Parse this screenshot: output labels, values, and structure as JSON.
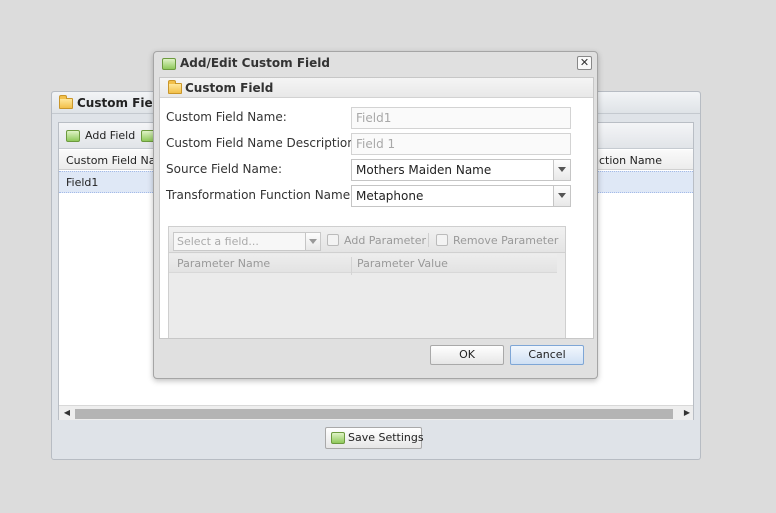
{
  "background_panel": {
    "title": "Custom Field C",
    "toolbar": {
      "add_field_label": "Add Field"
    },
    "columns": [
      "Custom Field Nam",
      "nction Name"
    ],
    "rows": [
      {
        "name": "Field1"
      }
    ],
    "save_button_label": "Save Settings"
  },
  "dialog": {
    "title": "Add/Edit Custom Field",
    "close_glyph": "✕",
    "section_title": "Custom Field",
    "fields": {
      "custom_field_name": {
        "label": "Custom Field Name:",
        "value": "Field1"
      },
      "custom_field_description": {
        "label": "Custom Field Name Description:",
        "value": "Field 1"
      },
      "source_field_name": {
        "label": "Source Field Name:",
        "value": "Mothers Maiden Name"
      },
      "transformation_function": {
        "label": "Transformation Function Name:",
        "value": "Metaphone"
      }
    },
    "parameters": {
      "select_placeholder": "Select a field...",
      "add_parameter_label": "Add Parameter",
      "remove_parameter_label": "Remove Parameter",
      "columns": [
        "Parameter Name",
        "Parameter Value"
      ]
    },
    "ok_label": "OK",
    "cancel_label": "Cancel"
  },
  "icons": {
    "folder": "folder-icon",
    "add": "add-icon",
    "save": "save-icon",
    "close": "close-icon",
    "dropdown": "chevron-down-icon"
  },
  "colors": {
    "selected_row": "#dfe8f6",
    "cancel_button": "#cfe0f4"
  }
}
